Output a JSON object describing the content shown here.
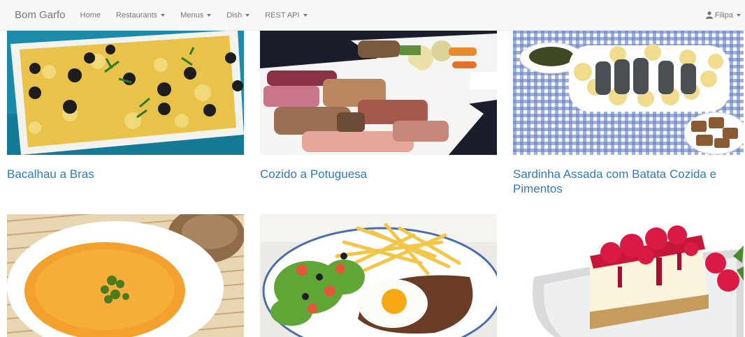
{
  "navbar": {
    "brand": "Bom Garfo",
    "items": [
      {
        "label": "Home",
        "dropdown": false
      },
      {
        "label": "Restaurants",
        "dropdown": true
      },
      {
        "label": "Menus",
        "dropdown": true
      },
      {
        "label": "Dish",
        "dropdown": true
      },
      {
        "label": "REST API",
        "dropdown": true
      }
    ],
    "user": "Filipa"
  },
  "dishes": [
    {
      "name": "Bacalhau a Bras",
      "image": "bacalhau-image"
    },
    {
      "name": "Cozido a Potuguesa",
      "image": "cozido-image"
    },
    {
      "name": "Sardinha Assada com Batata Cozida e Pimentos",
      "image": "sardinha-image"
    },
    {
      "name": "",
      "image": "soup-image"
    },
    {
      "name": "",
      "image": "steak-egg-image"
    },
    {
      "name": "",
      "image": "cheesecake-image"
    }
  ],
  "colors": {
    "link": "#337ab7",
    "navbar_bg": "#f8f8f8",
    "nav_text": "#777777"
  }
}
